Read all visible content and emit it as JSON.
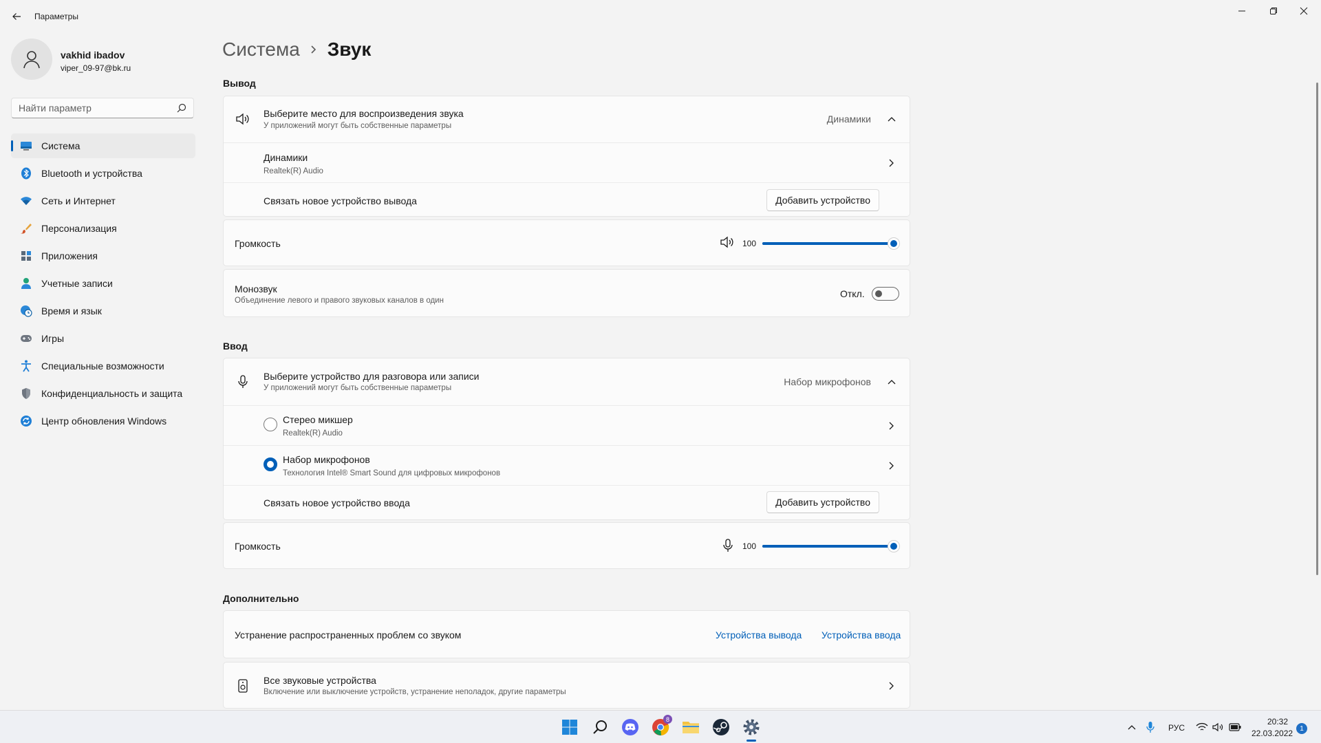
{
  "app": {
    "title": "Параметры"
  },
  "user": {
    "name": "vakhid ibadov",
    "email": "viper_09-97@bk.ru"
  },
  "search": {
    "placeholder": "Найти параметр"
  },
  "nav": {
    "items": [
      {
        "label": "Система",
        "icon": "system-icon"
      },
      {
        "label": "Bluetooth и устройства",
        "icon": "bluetooth-icon"
      },
      {
        "label": "Сеть и Интернет",
        "icon": "wifi-icon"
      },
      {
        "label": "Персонализация",
        "icon": "brush-icon"
      },
      {
        "label": "Приложения",
        "icon": "apps-icon"
      },
      {
        "label": "Учетные записи",
        "icon": "account-icon"
      },
      {
        "label": "Время и язык",
        "icon": "globe-clock-icon"
      },
      {
        "label": "Игры",
        "icon": "gamepad-icon"
      },
      {
        "label": "Специальные возможности",
        "icon": "accessibility-icon"
      },
      {
        "label": "Конфиденциальность и защита",
        "icon": "shield-icon"
      },
      {
        "label": "Центр обновления Windows",
        "icon": "update-icon"
      }
    ]
  },
  "breadcrumb": {
    "parent": "Система",
    "current": "Звук"
  },
  "output": {
    "section_title": "Вывод",
    "choose_title": "Выберите место для воспроизведения звука",
    "choose_subtitle": "У приложений могут быть собственные параметры",
    "selected": "Динамики",
    "device_name": "Динамики",
    "device_sub": "Realtek(R) Audio",
    "pair_label": "Связать новое устройство вывода",
    "add_button": "Добавить устройство",
    "volume_label": "Громкость",
    "volume_value": "100",
    "volume_level": 100,
    "mono_title": "Монозвук",
    "mono_subtitle": "Объединение левого и правого звуковых каналов в один",
    "mono_state": "Откл."
  },
  "input": {
    "section_title": "Ввод",
    "choose_title": "Выберите устройство для разговора или записи",
    "choose_subtitle": "У приложений могут быть собственные параметры",
    "selected": "Набор микрофонов",
    "device1_name": "Стерео микшер",
    "device1_sub": "Realtek(R) Audio",
    "device2_name": "Набор микрофонов",
    "device2_sub": "Технология Intel® Smart Sound для цифровых микрофонов",
    "pair_label": "Связать новое устройство ввода",
    "add_button": "Добавить устройство",
    "volume_label": "Громкость",
    "volume_value": "100",
    "volume_level": 100
  },
  "advanced": {
    "section_title": "Дополнительно",
    "troubleshoot_label": "Устранение распространенных проблем со звуком",
    "link_output": "Устройства вывода",
    "link_input": "Устройства ввода",
    "all_devices_title": "Все звуковые устройства",
    "all_devices_subtitle": "Включение или выключение устройств, устранение неполадок, другие параметры"
  },
  "taskbar": {
    "apps": [
      "windows-start-icon",
      "search-icon",
      "discord-icon",
      "chrome-icon",
      "file-explorer-icon",
      "steam-icon",
      "settings-icon"
    ],
    "chrome_badge": "8",
    "language": "РУС",
    "time": "20:32",
    "date": "22.03.2022",
    "notification_count": "1"
  },
  "colors": {
    "accent": "#005fb8",
    "background": "#f3f3f3",
    "card": "#fbfbfb"
  }
}
